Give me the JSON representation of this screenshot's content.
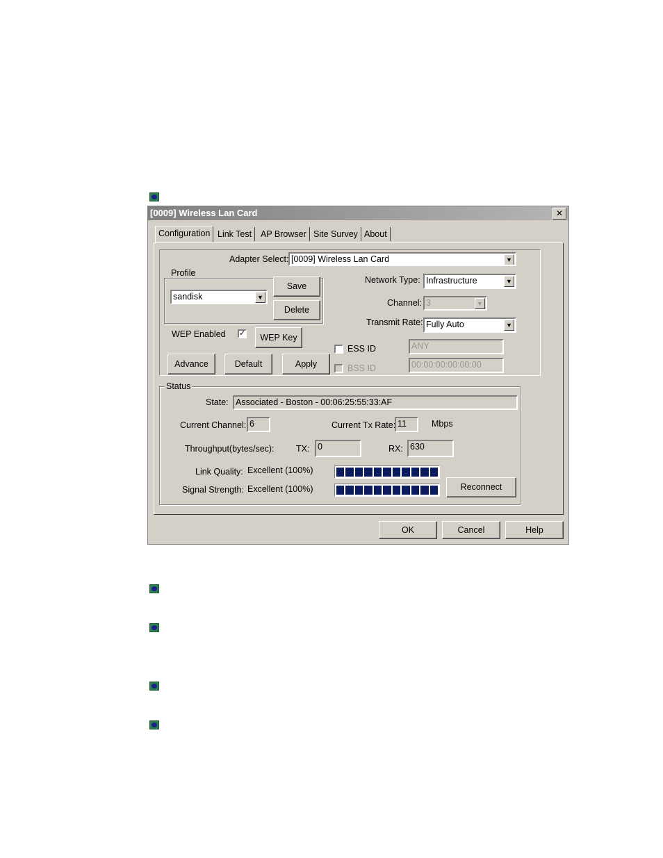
{
  "window": {
    "title": "[0009] Wireless Lan Card",
    "close_glyph": "✕"
  },
  "tabs": [
    "Configuration",
    "Link Test",
    "AP Browser",
    "Site Survey",
    "About"
  ],
  "config": {
    "adapter_select_label": "Adapter Select:",
    "adapter_select_value": "[0009] Wireless Lan Card",
    "profile_group_label": "Profile",
    "profile_value": "sandisk",
    "save_label": "Save",
    "delete_label": "Delete",
    "network_type_label": "Network Type:",
    "network_type_value": "Infrastructure",
    "channel_label": "Channel:",
    "channel_value": "3",
    "transmit_rate_label": "Transmit Rate:",
    "transmit_rate_value": "Fully Auto",
    "wep_enabled_label": "WEP Enabled",
    "wep_enabled_checked": true,
    "wep_key_label": "WEP Key",
    "ess_id_label": "ESS ID",
    "ess_id_value": "ANY",
    "bss_id_label": "BSS ID",
    "bss_id_value": "00:00:00:00:00:00",
    "advance_label": "Advance",
    "default_label": "Default",
    "apply_label": "Apply"
  },
  "status": {
    "group_label": "Status",
    "state_label": "State:",
    "state_value": "Associated - Boston - 00:06:25:55:33:AF",
    "current_channel_label": "Current Channel:",
    "current_channel_value": "6",
    "tx_rate_label": "Current Tx Rate:",
    "tx_rate_value": "11",
    "tx_rate_unit": "Mbps",
    "throughput_label": "Throughput(bytes/sec):",
    "tx_label": "TX:",
    "tx_value": "0",
    "rx_label": "RX:",
    "rx_value": "630",
    "link_quality_label": "Link Quality:",
    "link_quality_value": "Excellent (100%)",
    "link_quality_level": 1.0,
    "signal_strength_label": "Signal Strength:",
    "signal_strength_value": "Excellent (100%)",
    "signal_strength_level": 1.0,
    "reconnect_label": "Reconnect"
  },
  "footer": {
    "ok_label": "OK",
    "cancel_label": "Cancel",
    "help_label": "Help"
  },
  "colors": {
    "dialog_bg": "#d4d0c8",
    "bar_fill": "#0a1c5e",
    "bullet_green": "#2e7d4f",
    "bullet_blue": "#1c1f8c"
  },
  "icons": {
    "bullet": "bullet-icon",
    "dropdown": "dropdown-arrow-icon",
    "checkbox_mark": "checkmark-icon"
  }
}
